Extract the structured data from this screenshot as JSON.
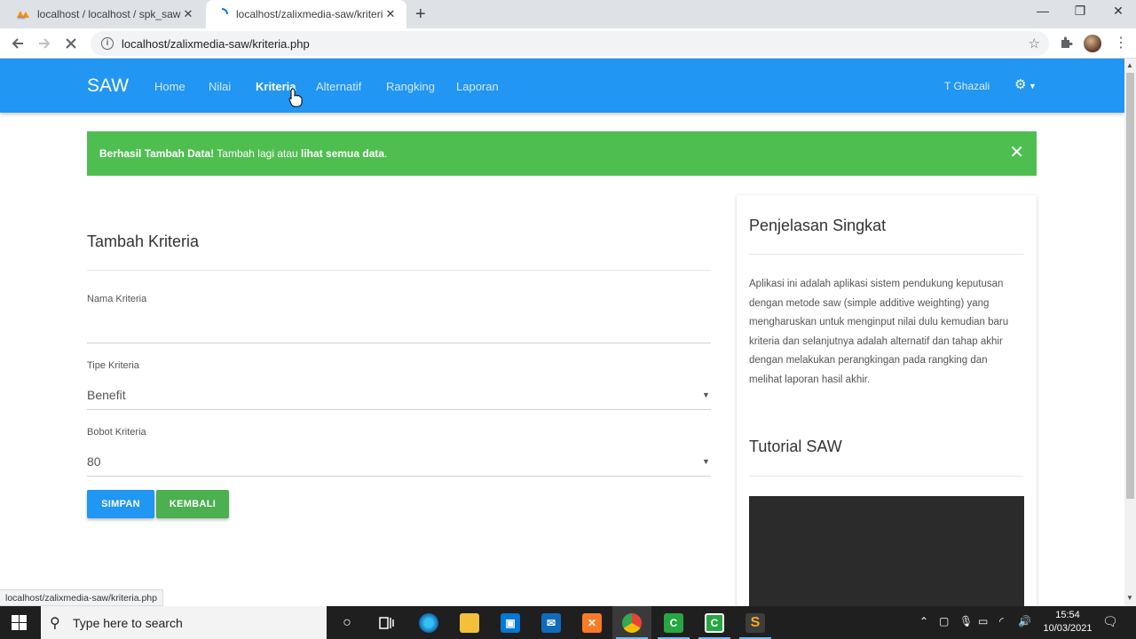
{
  "browser": {
    "tabs": [
      {
        "title": "localhost / localhost / spk_saw | p"
      },
      {
        "title": "localhost/zalixmedia-saw/kriteria"
      }
    ],
    "url": "localhost/zalixmedia-saw/kriteria.php",
    "status_url": "localhost/zalixmedia-saw/kriteria.php"
  },
  "navbar": {
    "brand": "SAW",
    "links": [
      "Home",
      "Nilai",
      "Kriteria",
      "Alternatif",
      "Rangking",
      "Laporan"
    ],
    "active": "Kriteria",
    "user": "T Ghazali"
  },
  "alert": {
    "strong": "Berhasil Tambah Data!",
    "text1": " Tambah lagi atau ",
    "link": "lihat semua data",
    "text2": "."
  },
  "form": {
    "title": "Tambah Kriteria",
    "nama_label": "Nama Kriteria",
    "nama_value": "",
    "tipe_label": "Tipe Kriteria",
    "tipe_value": "Benefit",
    "bobot_label": "Bobot Kriteria",
    "bobot_value": "80",
    "save_label": "SIMPAN",
    "back_label": "KEMBALI"
  },
  "sidebar": {
    "title": "Penjelasan Singkat",
    "text": "Aplikasi ini adalah aplikasi sistem pendukung keputusan dengan metode saw (simple additive weighting) yang mengharuskan untuk menginput nilai dulu kemudian baru kriteria dan selanjutnya adalah alternatif dan tahap akhir dengan melakukan perangkingan pada rangking dan melihat laporan hasil akhir.",
    "tutorial_title": "Tutorial SAW"
  },
  "taskbar": {
    "search_placeholder": "Type here to search",
    "time": "15:54",
    "date": "10/03/2021"
  },
  "colors": {
    "navbar": "#2196f3",
    "alert": "#4fbe50",
    "save_button": "#2196f3",
    "back_button": "#4caf50"
  }
}
